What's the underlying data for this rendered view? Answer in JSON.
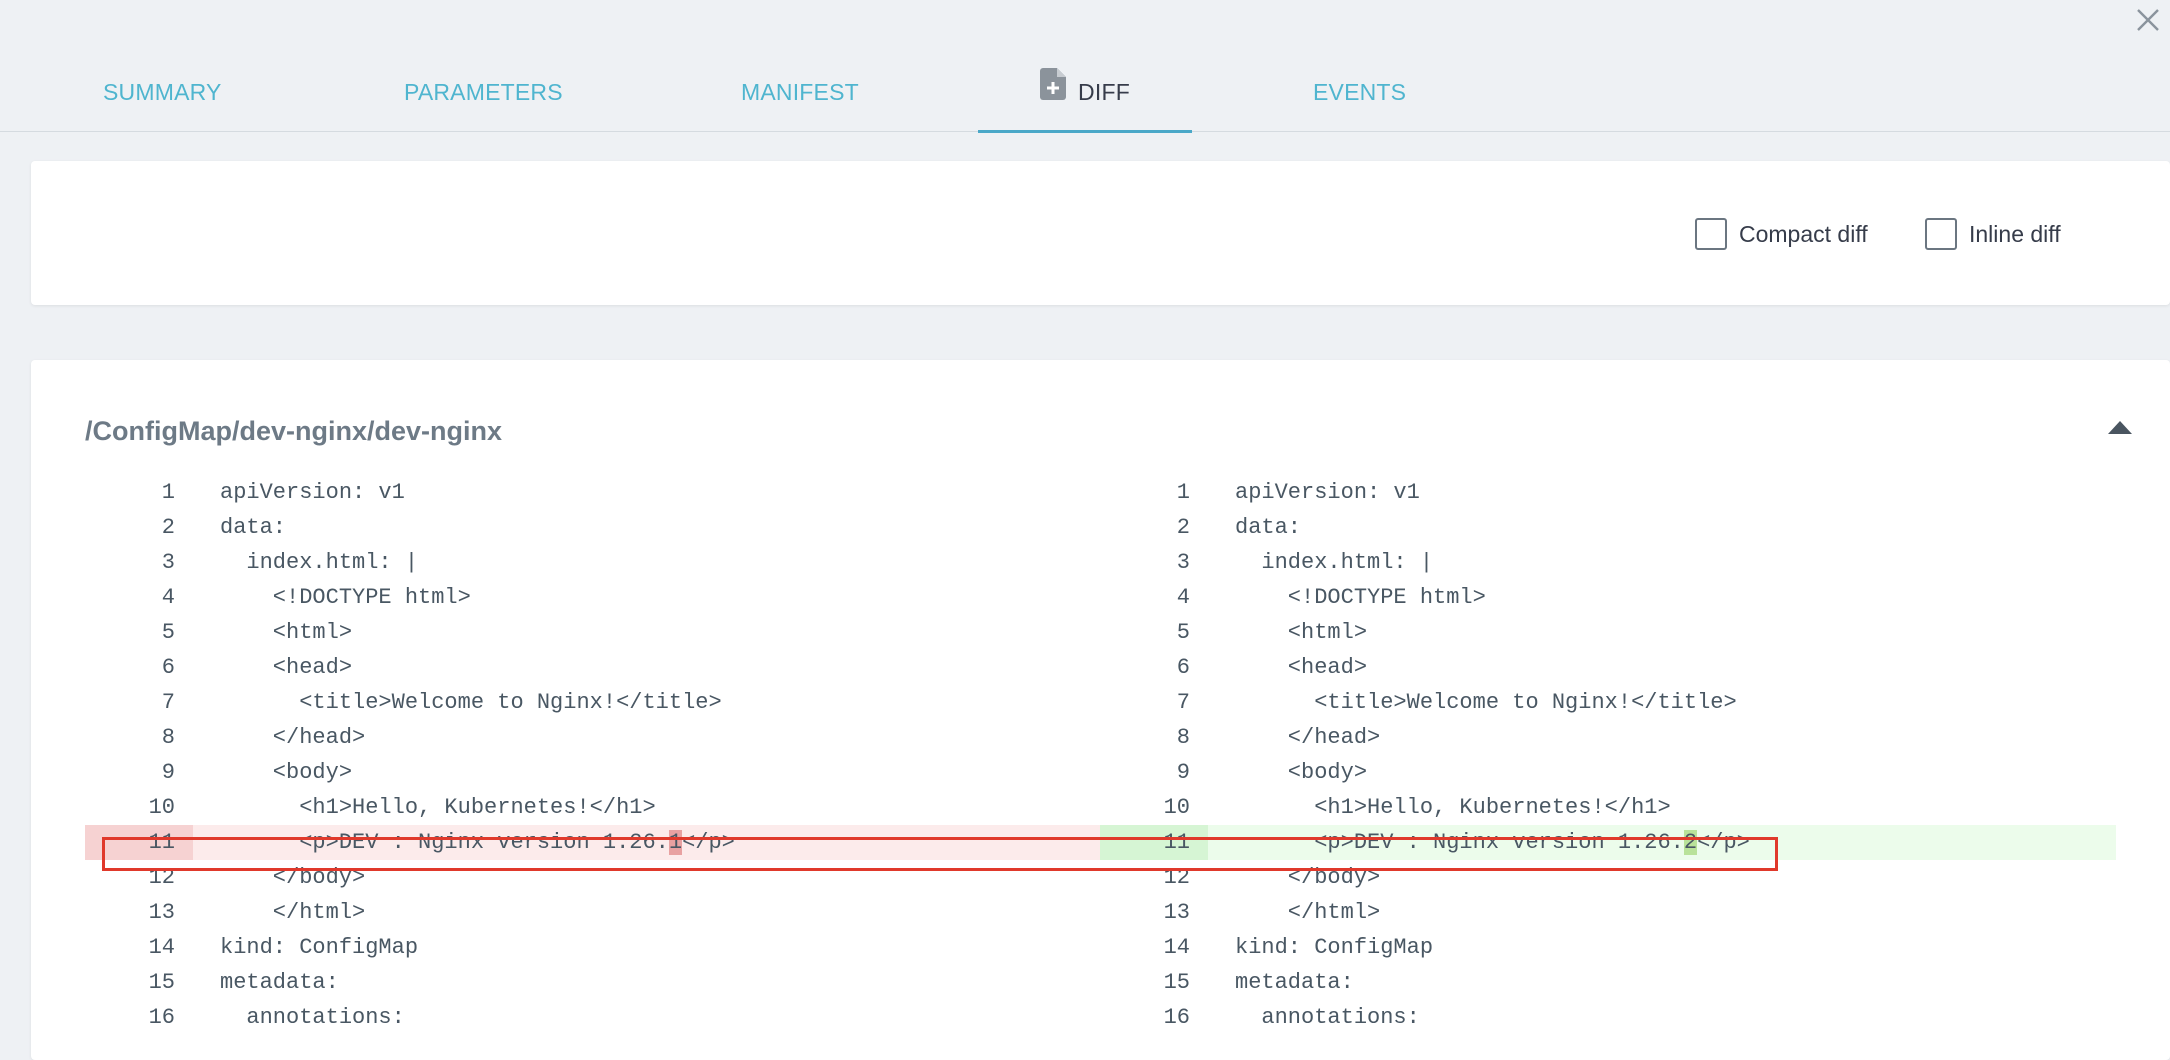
{
  "tabs": [
    {
      "label": "SUMMARY"
    },
    {
      "label": "PARAMETERS"
    },
    {
      "label": "MANIFEST"
    },
    {
      "label": "DIFF"
    },
    {
      "label": "EVENTS"
    }
  ],
  "active_tab": "DIFF",
  "options": {
    "compact_label": "Compact diff",
    "inline_label": "Inline diff"
  },
  "resource": {
    "title": "/ConfigMap/dev-nginx/dev-nginx"
  },
  "diff": {
    "left": [
      {
        "num": "1",
        "text": "apiVersion: v1"
      },
      {
        "num": "2",
        "text": "data:"
      },
      {
        "num": "3",
        "text": "  index.html: |"
      },
      {
        "num": "4",
        "text": "    <!DOCTYPE html>"
      },
      {
        "num": "5",
        "text": "    <html>"
      },
      {
        "num": "6",
        "text": "    <head>"
      },
      {
        "num": "7",
        "text": "      <title>Welcome to Nginx!</title>"
      },
      {
        "num": "8",
        "text": "    </head>"
      },
      {
        "num": "9",
        "text": "    <body>"
      },
      {
        "num": "10",
        "text": "      <h1>Hello, Kubernetes!</h1>"
      },
      {
        "num": "11",
        "pre": "      <p>DEV : Nginx version 1.26.",
        "changed": "1",
        "post": "</p>",
        "status": "removed"
      },
      {
        "num": "12",
        "text": "    </body>"
      },
      {
        "num": "13",
        "text": "    </html>"
      },
      {
        "num": "14",
        "text": "kind: ConfigMap"
      },
      {
        "num": "15",
        "text": "metadata:"
      },
      {
        "num": "16",
        "text": "  annotations:"
      }
    ],
    "right": [
      {
        "num": "1",
        "text": "apiVersion: v1"
      },
      {
        "num": "2",
        "text": "data:"
      },
      {
        "num": "3",
        "text": "  index.html: |"
      },
      {
        "num": "4",
        "text": "    <!DOCTYPE html>"
      },
      {
        "num": "5",
        "text": "    <html>"
      },
      {
        "num": "6",
        "text": "    <head>"
      },
      {
        "num": "7",
        "text": "      <title>Welcome to Nginx!</title>"
      },
      {
        "num": "8",
        "text": "    </head>"
      },
      {
        "num": "9",
        "text": "    <body>"
      },
      {
        "num": "10",
        "text": "      <h1>Hello, Kubernetes!</h1>"
      },
      {
        "num": "11",
        "pre": "      <p>DEV : Nginx version 1.26.",
        "changed": "2",
        "post": "</p>",
        "status": "added"
      },
      {
        "num": "12",
        "text": "    </body>"
      },
      {
        "num": "13",
        "text": "    </html>"
      },
      {
        "num": "14",
        "text": "kind: ConfigMap"
      },
      {
        "num": "15",
        "text": "metadata:"
      },
      {
        "num": "16",
        "text": "  annotations:"
      }
    ]
  },
  "colors": {
    "accent": "#4aa8c8",
    "tab_text": "#4fb5cf",
    "removed_bg": "#fcebeb",
    "added_bg": "#ecfceb",
    "highlight_border": "#e0392b"
  }
}
